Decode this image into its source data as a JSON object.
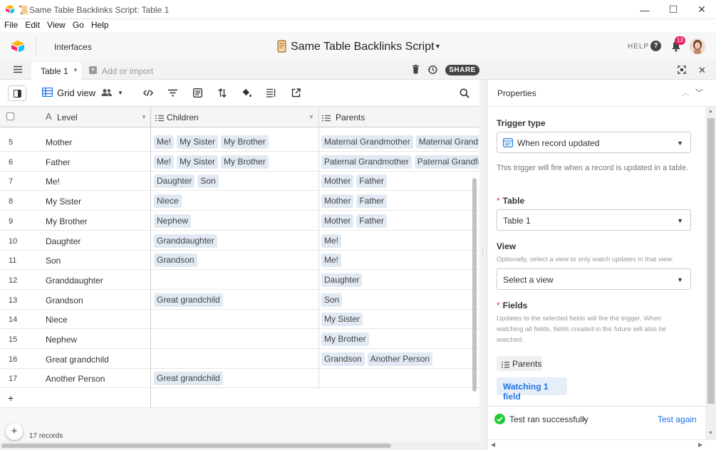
{
  "window": {
    "title": "📜Same Table Backlinks Script: Table 1",
    "minimize": "—",
    "maximize": "☐",
    "close": "✕"
  },
  "menu": [
    "File",
    "Edit",
    "View",
    "Go",
    "Help"
  ],
  "header": {
    "interfaces": "Interfaces",
    "base_title": "Same Table Backlinks Script",
    "help": "HELP",
    "notifications": "13"
  },
  "tabs": {
    "active": "Table 1",
    "add": "Add or import",
    "share": "SHARE"
  },
  "toolbar": {
    "view_name": "Grid view"
  },
  "grid": {
    "columns": [
      "Level",
      "Children",
      "Parents"
    ],
    "rows": [
      {
        "n": "5",
        "level": "Mother",
        "children": [
          "Me!",
          "My Sister",
          "My Brother"
        ],
        "parents": [
          "Maternal Grandmother",
          "Maternal Grandfath"
        ]
      },
      {
        "n": "6",
        "level": "Father",
        "children": [
          "Me!",
          "My Sister",
          "My Brother"
        ],
        "parents": [
          "Paternal Grandmother",
          "Paternal Grandfathe"
        ]
      },
      {
        "n": "7",
        "level": "Me!",
        "children": [
          "Daughter",
          "Son"
        ],
        "parents": [
          "Mother",
          "Father"
        ]
      },
      {
        "n": "8",
        "level": "My Sister",
        "children": [
          "Niece"
        ],
        "parents": [
          "Mother",
          "Father"
        ]
      },
      {
        "n": "9",
        "level": "My Brother",
        "children": [
          "Nephew"
        ],
        "parents": [
          "Mother",
          "Father"
        ]
      },
      {
        "n": "10",
        "level": "Daughter",
        "children": [
          "Granddaughter"
        ],
        "parents": [
          "Me!"
        ]
      },
      {
        "n": "11",
        "level": "Son",
        "children": [
          "Grandson"
        ],
        "parents": [
          "Me!"
        ]
      },
      {
        "n": "12",
        "level": "Granddaughter",
        "children": [],
        "parents": [
          "Daughter"
        ]
      },
      {
        "n": "13",
        "level": "Grandson",
        "children": [
          "Great grandchild"
        ],
        "parents": [
          "Son"
        ]
      },
      {
        "n": "14",
        "level": "Niece",
        "children": [],
        "parents": [
          "My Sister"
        ]
      },
      {
        "n": "15",
        "level": "Nephew",
        "children": [],
        "parents": [
          "My Brother"
        ]
      },
      {
        "n": "16",
        "level": "Great grandchild",
        "children": [],
        "parents": [
          "Grandson",
          "Another Person"
        ]
      },
      {
        "n": "17",
        "level": "Another Person",
        "children": [
          "Great grandchild"
        ],
        "parents": []
      }
    ],
    "add_row": "+",
    "record_count": "17 records"
  },
  "panel": {
    "title": "Properties",
    "trigger_type_label": "Trigger type",
    "trigger_type_value": "When record updated",
    "trigger_help": "This trigger will fire when a record is updated in a table.",
    "table_label": "Table",
    "table_value": "Table 1",
    "view_label": "View",
    "view_help": "Optionally, select a view to only watch updates in that view.",
    "view_value": "Select a view",
    "fields_label": "Fields",
    "fields_help": "Updates to the selected fields will fire the trigger. When watching all fields, fields created in the future will also be watched.",
    "field_chip": "Parents",
    "watching": "Watching 1 field",
    "test_status": "Test ran successfully",
    "test_again": "Test again"
  },
  "colors": {
    "accent": "#1a73e8",
    "success": "#20c933",
    "badge": "#e91e63",
    "pill": "#e1e9f3"
  }
}
